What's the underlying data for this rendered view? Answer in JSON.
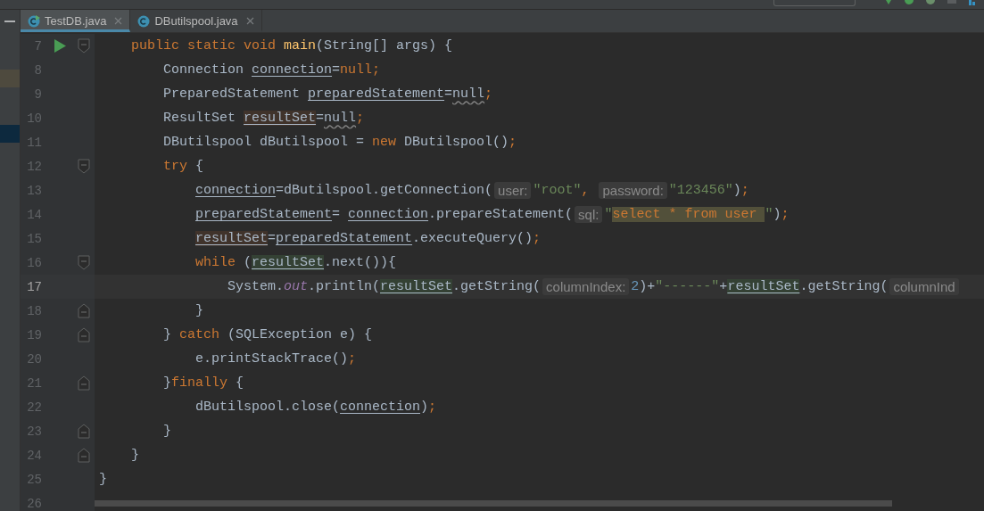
{
  "tabs": [
    {
      "label": "TestDB.java",
      "selected": true,
      "runnable": true
    },
    {
      "label": "DButilspool.java",
      "selected": false,
      "runnable": false
    }
  ],
  "class_body": [
    {
      "number": "7",
      "run": true,
      "fold_start": true,
      "current": false,
      "tokens": [
        {
          "text": "public static void ",
          "kind": "kw"
        },
        {
          "text": "main",
          "kind": "method"
        },
        {
          "text": "(String[] args) {",
          "kind": "txt"
        }
      ],
      "children": [
        {
          "number": "8",
          "current": false,
          "tokens": [
            {
              "text": "Connection ",
              "kind": "txt"
            },
            {
              "text": "connection",
              "kind": "var"
            },
            {
              "text": "=",
              "kind": "txt"
            },
            {
              "text": "null;",
              "kind": "kw"
            }
          ]
        },
        {
          "number": "9",
          "current": false,
          "tokens": [
            {
              "text": "PreparedStatement ",
              "kind": "txt"
            },
            {
              "text": "preparedStatement",
              "kind": "var"
            },
            {
              "text": "=",
              "kind": "txt"
            },
            {
              "text": "null",
              "kind": "weak"
            },
            {
              "text": ";",
              "kind": "kw"
            }
          ]
        },
        {
          "number": "10",
          "current": false,
          "tokens": [
            {
              "text": "ResultSet ",
              "kind": "txt"
            },
            {
              "text": "resultSet",
              "kind": "var",
              "written": true
            },
            {
              "text": "=",
              "kind": "txt"
            },
            {
              "text": "null",
              "kind": "weak"
            },
            {
              "text": ";",
              "kind": "kw"
            }
          ]
        },
        {
          "number": "11",
          "current": false,
          "tokens": [
            {
              "text": "DButilspool dButilspool = ",
              "kind": "txt"
            },
            {
              "text": "new",
              "kind": "kw"
            },
            {
              "text": " DButilspool()",
              "kind": "txt"
            },
            {
              "text": ";",
              "kind": "kw"
            }
          ]
        },
        {
          "number": "12",
          "fold_start": true,
          "current": false,
          "tokens": [
            {
              "text": "try",
              "kind": "kw"
            },
            {
              "text": " {",
              "kind": "txt"
            }
          ],
          "children": [
            {
              "number": "13",
              "current": false,
              "tokens": [
                {
                  "text": "connection",
                  "kind": "var"
                },
                {
                  "text": "=dButilspool.getConnection(",
                  "kind": "txt"
                },
                {
                  "text": "user:",
                  "kind": "hint"
                },
                {
                  "text": "\"root\"",
                  "kind": "str"
                },
                {
                  "text": ", ",
                  "kind": "kw"
                },
                {
                  "text": "password:",
                  "kind": "hint"
                },
                {
                  "text": "\"123456\"",
                  "kind": "str"
                },
                {
                  "text": ")",
                  "kind": "txt"
                },
                {
                  "text": ";",
                  "kind": "kw"
                }
              ]
            },
            {
              "number": "14",
              "current": false,
              "tokens": [
                {
                  "text": "preparedStatement",
                  "kind": "var"
                },
                {
                  "text": "= ",
                  "kind": "txt"
                },
                {
                  "text": "connection",
                  "kind": "var"
                },
                {
                  "text": ".prepareStatement(",
                  "kind": "txt"
                },
                {
                  "text": "sql:",
                  "kind": "hint"
                },
                {
                  "text": "\"",
                  "kind": "str"
                },
                {
                  "text": "select * from user ",
                  "kind": "kw",
                  "matched": true
                },
                {
                  "text": "\"",
                  "kind": "str"
                },
                {
                  "text": ")",
                  "kind": "txt"
                },
                {
                  "text": ";",
                  "kind": "kw"
                }
              ]
            },
            {
              "number": "15",
              "current": false,
              "tokens": [
                {
                  "text": "resultSet",
                  "kind": "var",
                  "written": true
                },
                {
                  "text": "=",
                  "kind": "txt"
                },
                {
                  "text": "preparedStatement",
                  "kind": "var"
                },
                {
                  "text": ".executeQuery()",
                  "kind": "txt"
                },
                {
                  "text": ";",
                  "kind": "kw"
                }
              ]
            },
            {
              "number": "16",
              "fold_start": true,
              "current": false,
              "tokens": [
                {
                  "text": "while",
                  "kind": "kw"
                },
                {
                  "text": " (",
                  "kind": "txt"
                },
                {
                  "text": "resultSet",
                  "kind": "var",
                  "read": true
                },
                {
                  "text": ".next()){",
                  "kind": "txt"
                }
              ],
              "children": [
                {
                  "number": "17",
                  "current": true,
                  "tokens": [
                    {
                      "text": "System.",
                      "kind": "txt"
                    },
                    {
                      "text": "out",
                      "kind": "field"
                    },
                    {
                      "text": ".println(",
                      "kind": "txt"
                    },
                    {
                      "text": "resultSet",
                      "kind": "var",
                      "read": true
                    },
                    {
                      "text": ".getString(",
                      "kind": "txt"
                    },
                    {
                      "text": "columnIndex:",
                      "kind": "hint"
                    },
                    {
                      "text": "2",
                      "kind": "num"
                    },
                    {
                      "text": ")+",
                      "kind": "txt"
                    },
                    {
                      "text": "\"------\"",
                      "kind": "str"
                    },
                    {
                      "text": "+",
                      "kind": "txt"
                    },
                    {
                      "text": "resultSet",
                      "kind": "var",
                      "read": true
                    },
                    {
                      "text": ".getString(",
                      "kind": "txt"
                    },
                    {
                      "text": "columnInd",
                      "kind": "hint"
                    }
                  ]
                }
              ]
            },
            {
              "number": "18",
              "fold_end": true,
              "current": false,
              "tokens": [
                {
                  "text": "}",
                  "kind": "txt"
                }
              ]
            }
          ]
        },
        {
          "number": "19",
          "fold_end": true,
          "current": false,
          "tokens": [
            {
              "text": "} ",
              "kind": "txt"
            },
            {
              "text": "catch",
              "kind": "kw"
            },
            {
              "text": " (SQLException e) {",
              "kind": "txt"
            }
          ],
          "children": [
            {
              "number": "20",
              "current": false,
              "tokens": [
                {
                  "text": "e.printStackTrace()",
                  "kind": "txt"
                },
                {
                  "text": ";",
                  "kind": "kw"
                }
              ]
            }
          ]
        },
        {
          "number": "21",
          "fold_end": true,
          "current": false,
          "tokens": [
            {
              "text": "}",
              "kind": "txt"
            },
            {
              "text": "finally",
              "kind": "kw"
            },
            {
              "text": " {",
              "kind": "txt"
            }
          ],
          "children": [
            {
              "number": "22",
              "current": false,
              "tokens": [
                {
                  "text": "dButilspool.close(",
                  "kind": "txt"
                },
                {
                  "text": "connection",
                  "kind": "var"
                },
                {
                  "text": ")",
                  "kind": "txt"
                },
                {
                  "text": ";",
                  "kind": "kw"
                }
              ]
            }
          ]
        },
        {
          "number": "23",
          "fold_end": true,
          "current": false,
          "tokens": [
            {
              "text": "}",
              "kind": "txt"
            }
          ]
        }
      ]
    },
    {
      "number": "24",
      "fold_end": true,
      "current": false,
      "tokens": [
        {
          "text": "}",
          "kind": "txt"
        }
      ]
    }
  ],
  "trailing_lines": [
    {
      "number": "25",
      "current": false,
      "tokens": [
        {
          "text": "}",
          "kind": "txt"
        }
      ]
    },
    {
      "number": "26",
      "current": false
    }
  ]
}
